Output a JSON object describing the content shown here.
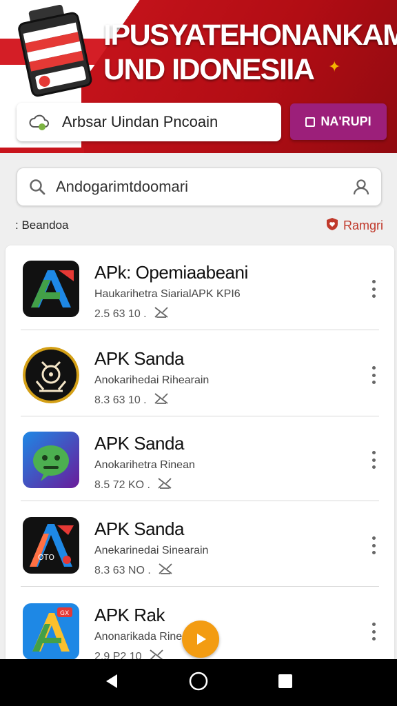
{
  "banner": {
    "title_line1": "IPUSYATEHONANKAM",
    "title_line2": "UND IDONESIIA",
    "promo_input_value": "Arbsar Uindan Pncoain",
    "promo_button_label": "NA'RUPI",
    "accent": "#c8141c",
    "button_color": "#9c1f7a"
  },
  "search": {
    "placeholder": "Andogarimtdoomari"
  },
  "section": {
    "left_label": ": Beandoa",
    "right_label": "Ramgri"
  },
  "apps": [
    {
      "name": "APk: Opemiaabeani",
      "subtitle": "Haukarihetra SiarialAPK KPI6",
      "meta": "2.5 63  10 .",
      "icon": "a-logo-icon"
    },
    {
      "name": "APK Sanda",
      "subtitle": "Anokarihedai Rihearain",
      "meta": "8.3 63  10 .",
      "icon": "robot-face-icon"
    },
    {
      "name": "APK Sanda",
      "subtitle": "Anokarihetra Rinean",
      "meta": "8.5 72  KO .",
      "icon": "android-chat-icon"
    },
    {
      "name": "APK Sanda",
      "subtitle": "Anekarinedai Sinearain",
      "meta": "8.3 63  NO .",
      "icon": "a-fire-logo-icon"
    },
    {
      "name": "APK Rak",
      "subtitle": "Anonarikada Rine",
      "meta": "2.9 P2  10",
      "icon": "a-green-logo-icon"
    }
  ]
}
